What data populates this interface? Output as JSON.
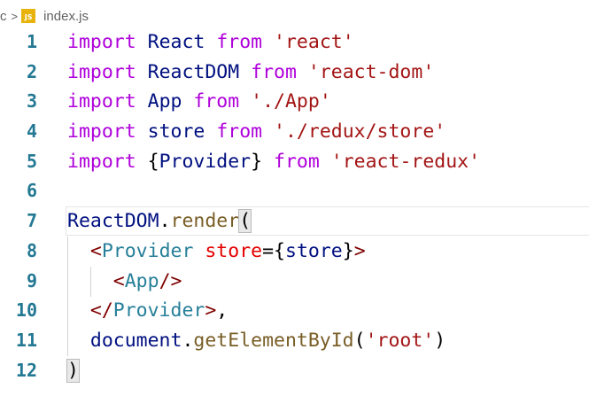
{
  "breadcrumb": {
    "parent": "c",
    "separator": ">",
    "file_icon": "JS",
    "file": "index.js"
  },
  "colors": {
    "keyword": "#af00db",
    "string": "#a31515",
    "identifier": "#001080",
    "class": "#267f99",
    "function": "#795e26",
    "tag_bracket": "#800000",
    "jsx_attribute": "#e50000",
    "line_number": "#237893"
  },
  "lines": [
    {
      "n": "1",
      "tokens": [
        {
          "t": "import",
          "c": "kw"
        },
        {
          "t": " "
        },
        {
          "t": "React",
          "c": "id"
        },
        {
          "t": " "
        },
        {
          "t": "from",
          "c": "kw"
        },
        {
          "t": " "
        },
        {
          "t": "'react'",
          "c": "str"
        }
      ]
    },
    {
      "n": "2",
      "tokens": [
        {
          "t": "import",
          "c": "kw"
        },
        {
          "t": " "
        },
        {
          "t": "ReactDOM",
          "c": "id"
        },
        {
          "t": " "
        },
        {
          "t": "from",
          "c": "kw"
        },
        {
          "t": " "
        },
        {
          "t": "'react-dom'",
          "c": "str"
        }
      ]
    },
    {
      "n": "3",
      "tokens": [
        {
          "t": "import",
          "c": "kw"
        },
        {
          "t": " "
        },
        {
          "t": "App",
          "c": "id"
        },
        {
          "t": " "
        },
        {
          "t": "from",
          "c": "kw"
        },
        {
          "t": " "
        },
        {
          "t": "'./App'",
          "c": "str"
        }
      ]
    },
    {
      "n": "4",
      "tokens": [
        {
          "t": "import",
          "c": "kw"
        },
        {
          "t": " "
        },
        {
          "t": "store",
          "c": "id"
        },
        {
          "t": " "
        },
        {
          "t": "from",
          "c": "kw"
        },
        {
          "t": " "
        },
        {
          "t": "'./redux/store'",
          "c": "str"
        }
      ]
    },
    {
      "n": "5",
      "tokens": [
        {
          "t": "import",
          "c": "kw"
        },
        {
          "t": " "
        },
        {
          "t": "{",
          "c": "pun"
        },
        {
          "t": "Provider",
          "c": "id"
        },
        {
          "t": "}",
          "c": "pun"
        },
        {
          "t": " "
        },
        {
          "t": "from",
          "c": "kw"
        },
        {
          "t": " "
        },
        {
          "t": "'react-redux'",
          "c": "str"
        }
      ]
    },
    {
      "n": "6",
      "tokens": []
    },
    {
      "n": "7",
      "tokens": [
        {
          "t": "ReactDOM",
          "c": "id"
        },
        {
          "t": ".",
          "c": "pun"
        },
        {
          "t": "render",
          "c": "fn"
        },
        {
          "t": "(",
          "c": "pun",
          "m": true
        }
      ]
    },
    {
      "n": "8",
      "tokens": [
        {
          "t": "  "
        },
        {
          "t": "<",
          "c": "tag"
        },
        {
          "t": "Provider",
          "c": "comp"
        },
        {
          "t": " "
        },
        {
          "t": "store",
          "c": "attr"
        },
        {
          "t": "=",
          "c": "pun"
        },
        {
          "t": "{",
          "c": "pun"
        },
        {
          "t": "store",
          "c": "id"
        },
        {
          "t": "}",
          "c": "pun"
        },
        {
          "t": ">",
          "c": "tag"
        }
      ]
    },
    {
      "n": "9",
      "tokens": [
        {
          "t": "    "
        },
        {
          "t": "<",
          "c": "tag"
        },
        {
          "t": "App",
          "c": "comp"
        },
        {
          "t": "/>",
          "c": "tag"
        }
      ]
    },
    {
      "n": "10",
      "tokens": [
        {
          "t": "  "
        },
        {
          "t": "</",
          "c": "tag"
        },
        {
          "t": "Provider",
          "c": "comp"
        },
        {
          "t": ">",
          "c": "tag"
        },
        {
          "t": ",",
          "c": "pun"
        }
      ]
    },
    {
      "n": "11",
      "tokens": [
        {
          "t": "  "
        },
        {
          "t": "document",
          "c": "id"
        },
        {
          "t": ".",
          "c": "pun"
        },
        {
          "t": "getElementById",
          "c": "fn"
        },
        {
          "t": "(",
          "c": "pun"
        },
        {
          "t": "'root'",
          "c": "str"
        },
        {
          "t": ")",
          "c": "pun"
        }
      ]
    },
    {
      "n": "12",
      "tokens": [
        {
          "t": ")",
          "c": "pun",
          "m": true
        }
      ]
    }
  ]
}
